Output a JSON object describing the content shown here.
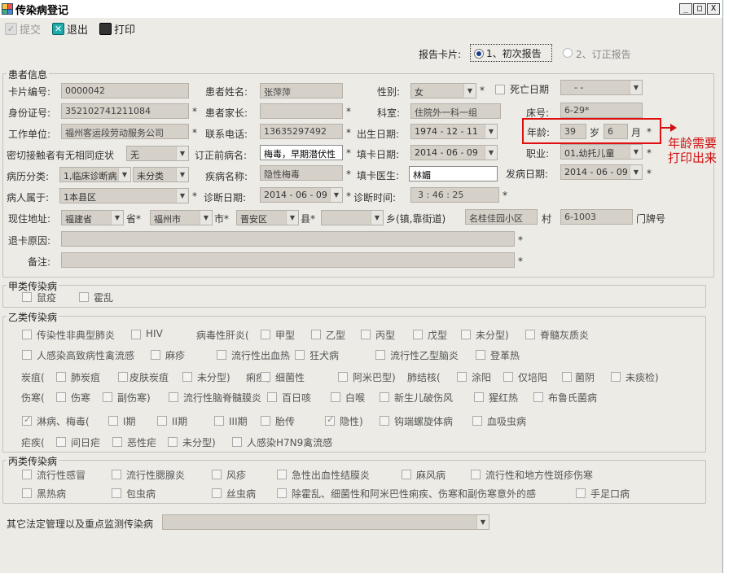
{
  "window": {
    "title": "传染病登记",
    "btn_min": "_",
    "btn_max": "□",
    "btn_close": "X"
  },
  "toolbar": {
    "submit": "提交",
    "exit": "退出",
    "print": "打印"
  },
  "card": {
    "label": "报告卡片:",
    "opt1": "1、初次报告",
    "opt2": "2、订正报告",
    "selected": "1、初次报告"
  },
  "patient": {
    "section": "患者信息",
    "card_no_label": "卡片编号:",
    "card_no": "0000042",
    "name_label": "患者姓名:",
    "name": "张萍萍",
    "gender_label": "性别:",
    "gender": "女",
    "death_label": "死亡日期",
    "death_date": "-  -",
    "id_label": "身份证号:",
    "id": "352102741211084",
    "parent_label": "患者家长:",
    "parent": "",
    "dept_label": "科室:",
    "dept": "住院外一科一组",
    "bed_label": "床号:",
    "bed": "6-29*",
    "work_label": "工作单位:",
    "work": "福州客运段劳动服务公司",
    "phone_label": "联系电话:",
    "phone": "13635297492",
    "birth_label": "出生日期:",
    "birth": "1974 - 12 - 11",
    "age_label": "年龄:",
    "age_years": "39",
    "age_years_unit": "岁",
    "age_months": "6",
    "age_months_unit": "月",
    "contact_label": "密切接触者有无相同症状",
    "contact": "无",
    "before_label": "订正前病名:",
    "before": "梅毒，早期潜伏性",
    "fill_date_label": "填卡日期:",
    "fill_date": "2014 - 06 - 09",
    "job_label": "职业:",
    "job": "01,幼托儿童",
    "case_label": "病历分类:",
    "case_type": "1,临床诊断病",
    "case_sub": "未分类",
    "disease_label": "疾病名称:",
    "disease": "隐性梅毒",
    "doctor_label": "填卡医生:",
    "doctor": "林媚",
    "onset_label": "发病日期:",
    "onset": "2014 - 06 - 09",
    "belong_label": "病人属于:",
    "belong": "1本县区",
    "diag_date_label": "诊断日期:",
    "diag_date": "2014 - 06 - 09",
    "diag_time_label": "诊断时间:",
    "diag_time": "3 : 46 : 25",
    "addr_label": "现住地址:",
    "province": "福建省",
    "province_unit": "省*",
    "city": "福州市",
    "city_unit": "市*",
    "district": "晋安区",
    "district_unit": "县*",
    "town": "",
    "town_unit": "乡(镇,靠街道)",
    "village": "名桂佳园小区",
    "village_unit": "村",
    "house": "6-1003",
    "house_unit": "门牌号",
    "reject_label": "退卡原因:",
    "note_label": "备注:"
  },
  "annotation": {
    "text": "年龄需要打印出来"
  },
  "class_a": {
    "title": "甲类传染病",
    "items": [
      "鼠疫",
      "霍乱"
    ]
  },
  "class_b": {
    "title": "乙类传染病",
    "r1": [
      "传染性非典型肺炎",
      "HIV",
      "病毒性肝炎(",
      "甲型",
      "乙型",
      "丙型",
      "戊型",
      "未分型)",
      "脊髓灰质炎"
    ],
    "r2": [
      "人感染高致病性禽流感",
      "麻疹",
      "流行性出血热",
      "狂犬病",
      "流行性乙型脑炎",
      "登革热"
    ],
    "r3": [
      "炭疽(",
      "肺炭疽",
      "皮肤炭疽",
      "未分型)",
      "痢疾(",
      "细菌性",
      "阿米巴型)",
      "肺结核(",
      "涂阳",
      "仅培阳",
      "菌阴",
      "未痰检)"
    ],
    "r4": [
      "伤寒(",
      "伤寒",
      "副伤寒)",
      "流行性脑脊髓膜炎",
      "百日咳",
      "白喉",
      "新生儿破伤风",
      "猩红热",
      "布鲁氏菌病"
    ],
    "r5": [
      "淋病、梅毒(",
      "I期",
      "II期",
      "III期",
      "胎传",
      "隐性)",
      "钩端螺旋体病",
      "血吸虫病"
    ],
    "r6": [
      "疟疾(",
      "间日疟",
      "恶性疟",
      "未分型)",
      "人感染H7N9禽流感"
    ]
  },
  "class_c": {
    "title": "丙类传染病",
    "r1": [
      "流行性感冒",
      "流行性腮腺炎",
      "风疹",
      "急性出血性结膜炎",
      "麻风病",
      "流行性和地方性斑疹伤寒"
    ],
    "r2": [
      "黑热病",
      "包虫病",
      "丝虫病",
      "除霍乱、细菌性和阿米巴性痢疾、伤寒和副伤寒意外的感",
      "手足口病"
    ]
  },
  "other": {
    "label": "其它法定管理以及重点监测传染病",
    "value": ""
  },
  "colors": {
    "highlight": "#e01010",
    "title_bg": "#ffffff",
    "field_bg": "#d5d0c8"
  }
}
